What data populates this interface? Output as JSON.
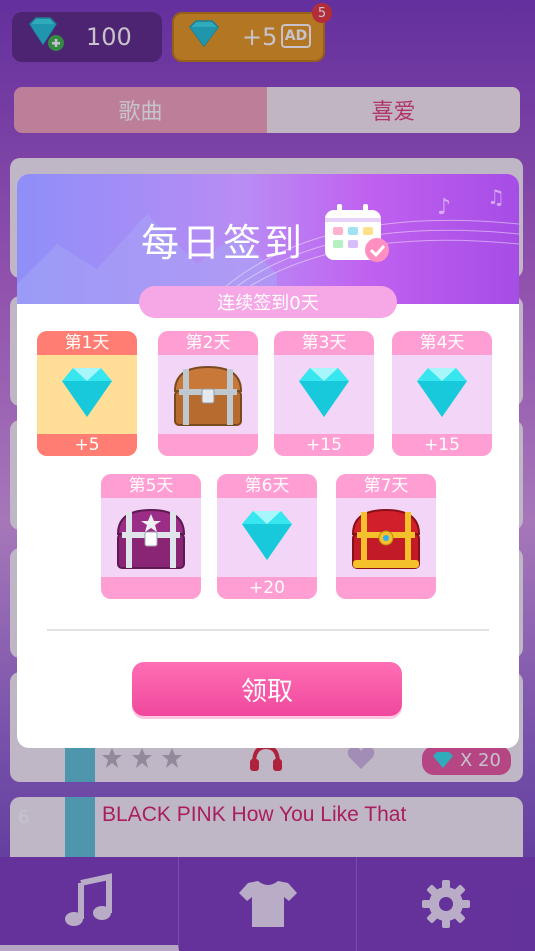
{
  "top": {
    "gems_count": "100",
    "ad_reward": "+5",
    "ad_label": "AD",
    "notification_count": "5"
  },
  "tabs": {
    "songs": "歌曲",
    "favorites": "喜爱"
  },
  "songs": [
    {
      "number": "6",
      "title": "BLACK PINK How You Like That"
    }
  ],
  "under_row": {
    "price": "X  20"
  },
  "dialog": {
    "title": "每日签到",
    "streak": "连续签到0天",
    "days": [
      {
        "label": "第1天",
        "reward": "gem",
        "amount": "+5"
      },
      {
        "label": "第2天",
        "reward": "wood-chest",
        "amount": ""
      },
      {
        "label": "第3天",
        "reward": "gem",
        "amount": "+15"
      },
      {
        "label": "第4天",
        "reward": "gem",
        "amount": "+15"
      },
      {
        "label": "第5天",
        "reward": "purple-chest",
        "amount": ""
      },
      {
        "label": "第6天",
        "reward": "gem",
        "amount": "+20"
      },
      {
        "label": "第7天",
        "reward": "gold-chest",
        "amount": ""
      }
    ],
    "claim_label": "领取"
  },
  "colors": {
    "accent_pink": "#f0479c",
    "header_purple": "#a64de6",
    "nav_purple": "#7c3fbe"
  }
}
